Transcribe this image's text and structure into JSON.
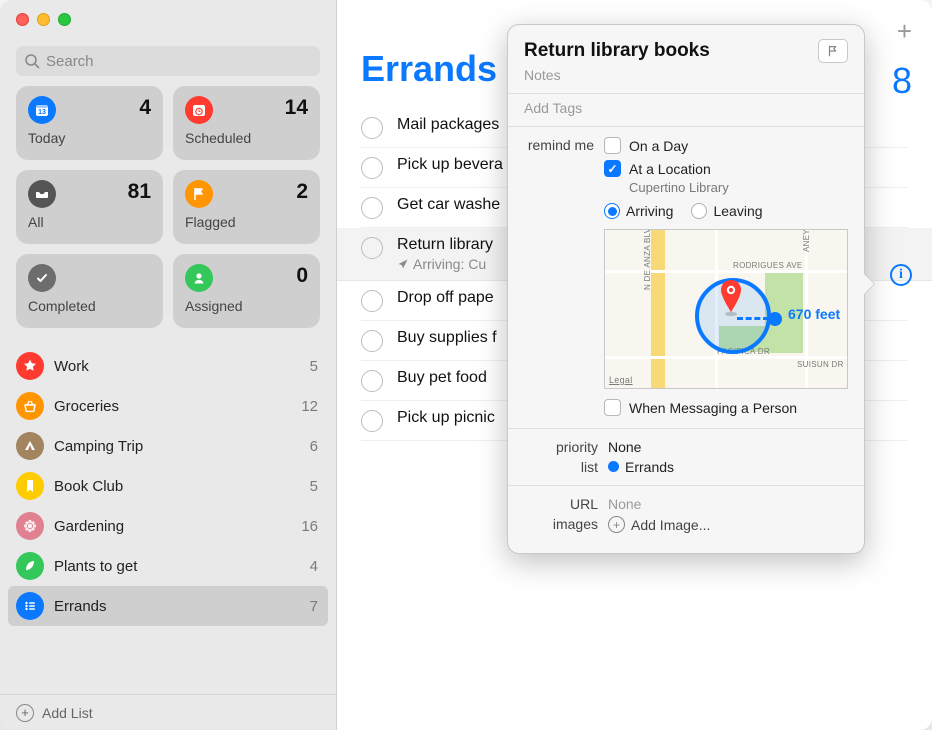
{
  "search": {
    "placeholder": "Search"
  },
  "smart": {
    "today": {
      "label": "Today",
      "count": "4"
    },
    "scheduled": {
      "label": "Scheduled",
      "count": "14"
    },
    "all": {
      "label": "All",
      "count": "81"
    },
    "flagged": {
      "label": "Flagged",
      "count": "2"
    },
    "completed": {
      "label": "Completed",
      "count": ""
    },
    "assigned": {
      "label": "Assigned",
      "count": "0"
    }
  },
  "lists": {
    "work": {
      "name": "Work",
      "count": "5"
    },
    "groceries": {
      "name": "Groceries",
      "count": "12"
    },
    "camping": {
      "name": "Camping Trip",
      "count": "6"
    },
    "bookclub": {
      "name": "Book Club",
      "count": "5"
    },
    "gardening": {
      "name": "Gardening",
      "count": "16"
    },
    "plants": {
      "name": "Plants to get",
      "count": "4"
    },
    "errands": {
      "name": "Errands",
      "count": "7"
    }
  },
  "addList": "Add List",
  "main": {
    "title": "Errands",
    "count": "8",
    "items": {
      "i0": {
        "title": "Mail packages"
      },
      "i1": {
        "title": "Pick up bevera"
      },
      "i2": {
        "title": "Get car washe"
      },
      "i3": {
        "title": "Return library",
        "sub": "Arriving: Cu"
      },
      "i4": {
        "title": "Drop off pape"
      },
      "i5": {
        "title": "Buy supplies f"
      },
      "i6": {
        "title": "Buy pet food"
      },
      "i7": {
        "title": "Pick up picnic"
      }
    }
  },
  "popover": {
    "title": "Return library books",
    "notes": "Notes",
    "tags": "Add Tags",
    "remindLabel": "remind me",
    "onDay": "On a Day",
    "atLocation": "At a Location",
    "locationName": "Cupertino Library",
    "arriving": "Arriving",
    "leaving": "Leaving",
    "distance": "670 feet",
    "whenMessaging": "When Messaging a Person",
    "priorityLabel": "priority",
    "priorityValue": "None",
    "listLabel": "list",
    "listValue": "Errands",
    "urlLabel": "URL",
    "urlValue": "None",
    "imagesLabel": "images",
    "addImage": "Add Image...",
    "map": {
      "deanza": "N DE ANZA BLVD",
      "rodrigues": "RODRIGUES AVE",
      "aney": "ANEY AVE",
      "pacifica": "PACIFICA DR",
      "suisun": "SUISUN DR",
      "legal": "Legal"
    }
  }
}
